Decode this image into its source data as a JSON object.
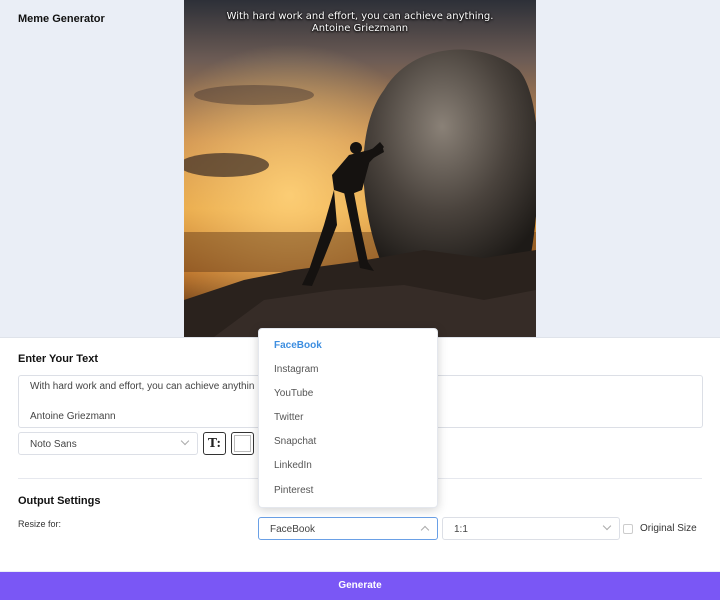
{
  "app": {
    "title": "Meme Generator"
  },
  "meme": {
    "line1": "With hard work and effort, you can achieve anything.",
    "line2": "Antoine Griezmann"
  },
  "editor": {
    "heading": "Enter Your Text",
    "text_line1": "With hard work and effort, you can achieve anythin",
    "text_line2": "Antoine Griezmann",
    "font": "Noto Sans",
    "text_style_icon": "T:",
    "text_color": "#ffffff"
  },
  "output": {
    "heading": "Output Settings",
    "resize_label": "Resize for:",
    "platform": "FaceBook",
    "ratio": "1:1",
    "original_size_label": "Original Size"
  },
  "dropdown": {
    "options": [
      "FaceBook",
      "Instagram",
      "YouTube",
      "Twitter",
      "Snapchat",
      "LinkedIn",
      "Pinterest"
    ],
    "selected": "FaceBook"
  },
  "actions": {
    "generate_label": "Generate"
  },
  "colors": {
    "accent": "#7a57f5",
    "selected_option": "#3d8ee0",
    "background": "#eaeef6"
  }
}
